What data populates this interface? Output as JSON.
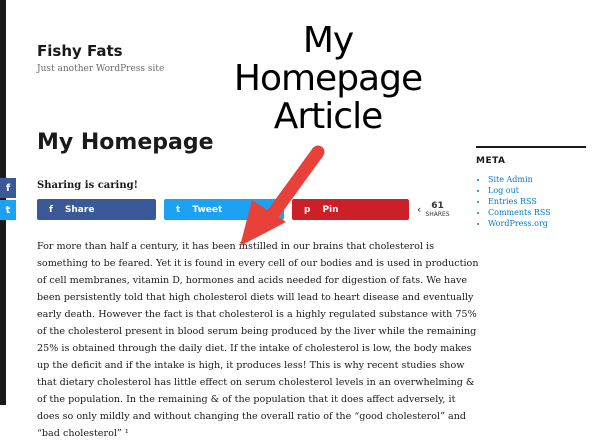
{
  "site": {
    "title": "Fishy Fats",
    "tagline": "Just another WordPress site"
  },
  "overlay": {
    "line1": "My",
    "line2": "Homepage",
    "line3": "Article"
  },
  "page": {
    "title": "My Homepage"
  },
  "sharing": {
    "label": "Sharing is caring!",
    "buttons": [
      {
        "label": "Share",
        "icon": "f"
      },
      {
        "label": "Tweet",
        "icon": "t"
      },
      {
        "label": "Pin",
        "icon": "p"
      }
    ],
    "count": "61",
    "count_label": "SHARES"
  },
  "floating_share": {
    "facebook_icon": "f",
    "twitter_icon": "t"
  },
  "article": {
    "body": "For more than half a century, it has been instilled in our brains that cholesterol is something to be feared. Yet it is found in every cell of our bodies and is used in production of cell membranes, vitamin D, hormones and acids needed for digestion of fats. We have been persistently told that high cholesterol diets will lead to heart disease and eventually early death. However the fact is that cholesterol is a highly regulated substance with 75% of the cholesterol present in blood serum being produced by the liver while the remaining 25% is obtained through the daily diet. If the intake of cholesterol is low, the body makes up the deficit and if the intake is high, it produces less! This is why recent studies show that dietary cholesterol has little effect on serum cholesterol levels in an overwhelming & of the population. In the remaining & of the population that it does affect adversely, it does so only mildly and without changing the overall ratio of the “good cholesterol” and “bad cholesterol” ¹"
  },
  "sidebar": {
    "heading": "META",
    "items": [
      {
        "label": "Site Admin"
      },
      {
        "label": "Log out"
      },
      {
        "label": "Entries RSS"
      },
      {
        "label": "Comments RSS"
      },
      {
        "label": "WordPress.org"
      }
    ]
  },
  "colors": {
    "facebook": "#3b5998",
    "twitter": "#1da1f2",
    "pinterest": "#cb2027",
    "link": "#007acc",
    "arrow": "#e8413a"
  }
}
